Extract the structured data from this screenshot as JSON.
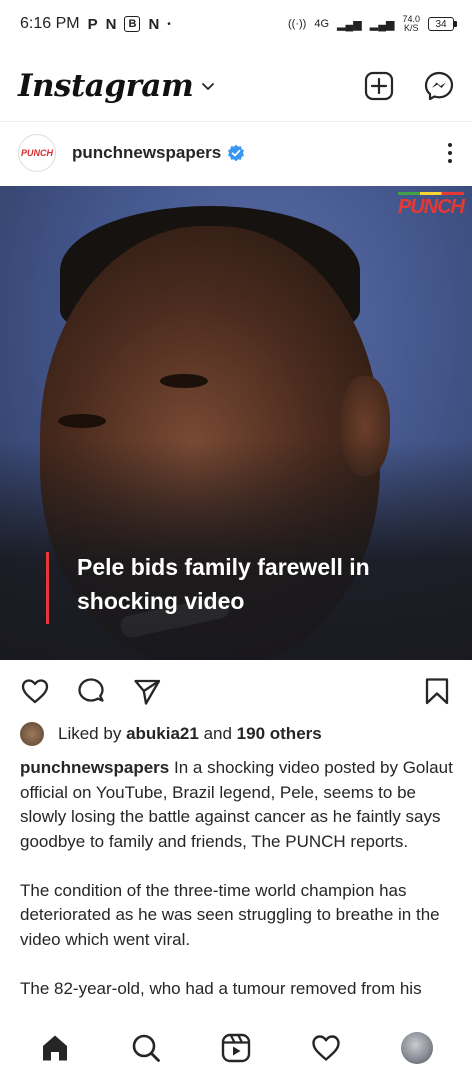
{
  "status_bar": {
    "time": "6:16 PM",
    "notif_icons": [
      "P",
      "N",
      "B",
      "N"
    ],
    "dot": "•",
    "network": "4G",
    "speed_value": "74.0",
    "speed_unit": "K/S",
    "battery": "34"
  },
  "header": {
    "logo": "Instagram",
    "icons": [
      "new-post-icon",
      "messenger-icon"
    ]
  },
  "post": {
    "avatar_text": "PUNCH",
    "username": "punchnewspapers",
    "verified": true,
    "media": {
      "brand": "PUNCH",
      "headline_line1": "Pele bids family farewell in",
      "headline_line2": "shocking video"
    },
    "likes": {
      "prefix": "Liked by",
      "user": "abukia21",
      "middle": "and",
      "others": "190 others"
    },
    "caption": {
      "user": "punchnewspapers",
      "p1": "In a shocking video posted by Golaut official on YouTube, Brazil legend, Pele, seems to be slowly losing the battle against cancer as he faintly says goodbye to family and friends, The PUNCH reports.",
      "p2": "The condition of the three-time world champion has deteriorated as he was seen struggling to breathe in the video which went viral.",
      "p3": "The 82-year-old, who had a tumour removed from his"
    }
  },
  "colors": {
    "accent_blue": "#3897f0",
    "brand_red": "#e53935",
    "text": "#262626"
  },
  "bottom_nav": [
    "home-icon",
    "search-icon",
    "reels-icon",
    "activity-icon",
    "profile-avatar"
  ]
}
